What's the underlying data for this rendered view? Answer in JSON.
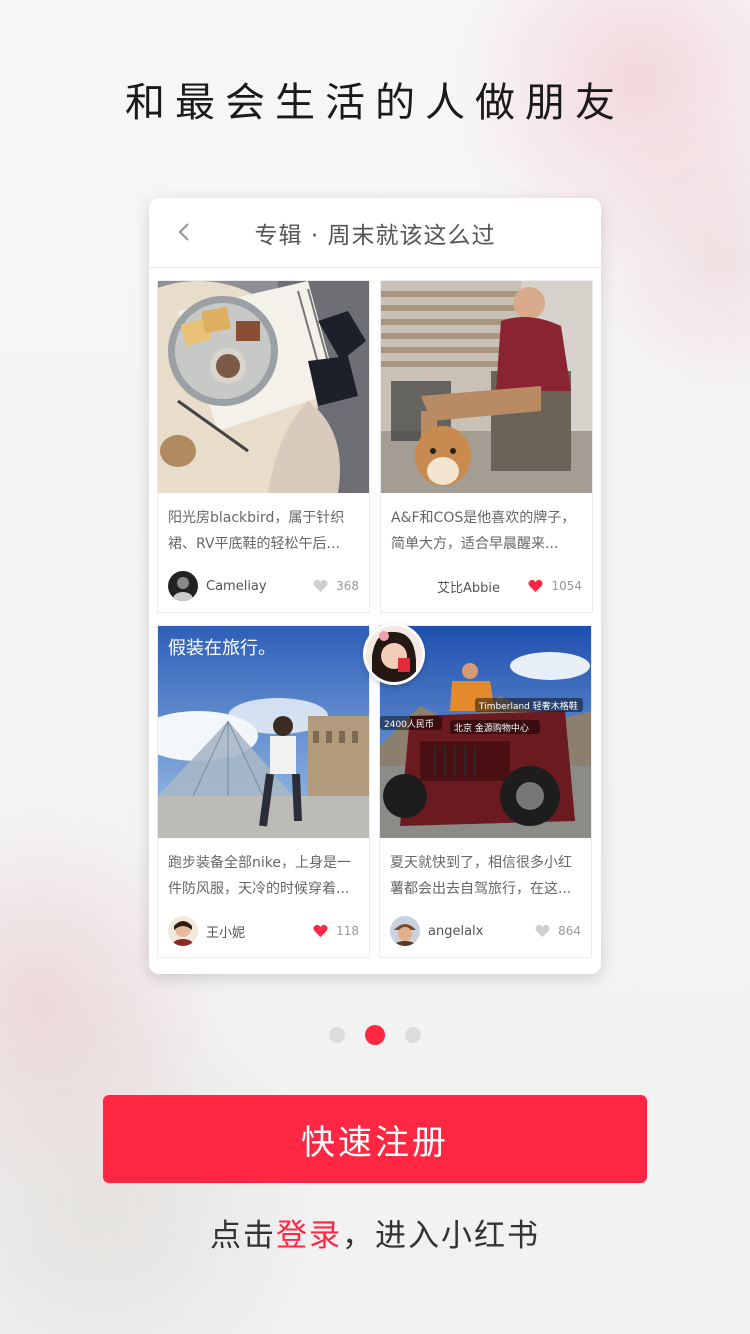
{
  "headline": "和最会生活的人做朋友",
  "card": {
    "title": "专辑 · 周末就该这么过",
    "posts": [
      {
        "desc": "阳光房blackbird，属于针织裙、RV平底鞋的轻松午后...",
        "user": "Cameliay",
        "likes": "368",
        "liked": false
      },
      {
        "desc": "A&F和COS是他喜欢的牌子，简单大方，适合早晨醒来...",
        "user": "艾比Abbie",
        "likes": "1054",
        "liked": true
      },
      {
        "desc": "跑步装备全部nike，上身是一件防风服，天冷的时候穿着...",
        "user": "王小妮",
        "likes": "118",
        "liked": true,
        "photo_text": "假装在旅行。"
      },
      {
        "desc": "夏天就快到了，相信很多小红薯都会出去自驾旅行，在这...",
        "user": "angelalx",
        "likes": "864",
        "liked": false,
        "photo_tag_1": "2400人民币",
        "photo_tag_2": "北京 金源购物中心",
        "photo_tag_3": "Timberland 轻奢木格鞋"
      }
    ]
  },
  "pagination": {
    "count": 3,
    "active": 1
  },
  "register_label": "快速注册",
  "login": {
    "prefix": "点击",
    "link": "登录",
    "suffix": "，进入小红书"
  },
  "colors": {
    "accent": "#ff2741",
    "like_red": "#ff2741",
    "like_grey": "#cfcfcf"
  }
}
